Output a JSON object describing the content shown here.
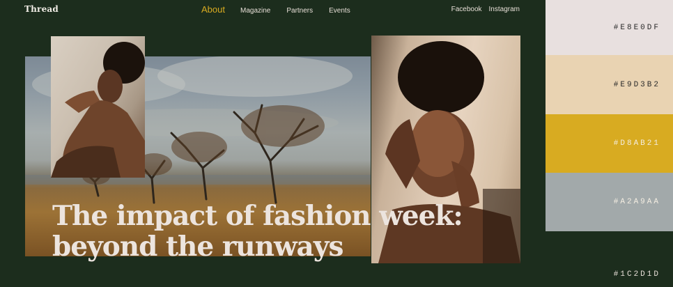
{
  "header": {
    "logo": "Thread",
    "nav": [
      {
        "label": "About",
        "active": true
      },
      {
        "label": "Magazine",
        "active": false
      },
      {
        "label": "Partners",
        "active": false
      },
      {
        "label": "Events",
        "active": false
      }
    ],
    "social": [
      "Facebook",
      "Instagram"
    ]
  },
  "hero": {
    "headline_line1": "The impact of fashion week:",
    "headline_line2": "beyond the runways"
  },
  "palette": [
    {
      "hex": "#E8E0DF",
      "label": "#E8E0DF",
      "text_color": "#2a2a2a"
    },
    {
      "hex": "#E9D3B2",
      "label": "#E9D3B2",
      "text_color": "#2a2a2a"
    },
    {
      "hex": "#D8AB21",
      "label": "#D8AB21",
      "text_color": "#F4EEE2"
    },
    {
      "hex": "#A2A9AA",
      "label": "#A2A9AA",
      "text_color": "#F4EEE2"
    },
    {
      "hex": "#1C2D1D",
      "label": "#1C2D1D",
      "text_color": "#E8E0D8"
    }
  ],
  "icons": {
    "landscape_image": "landscape-photo",
    "portrait_left": "portrait-photo",
    "portrait_right": "portrait-photo"
  }
}
